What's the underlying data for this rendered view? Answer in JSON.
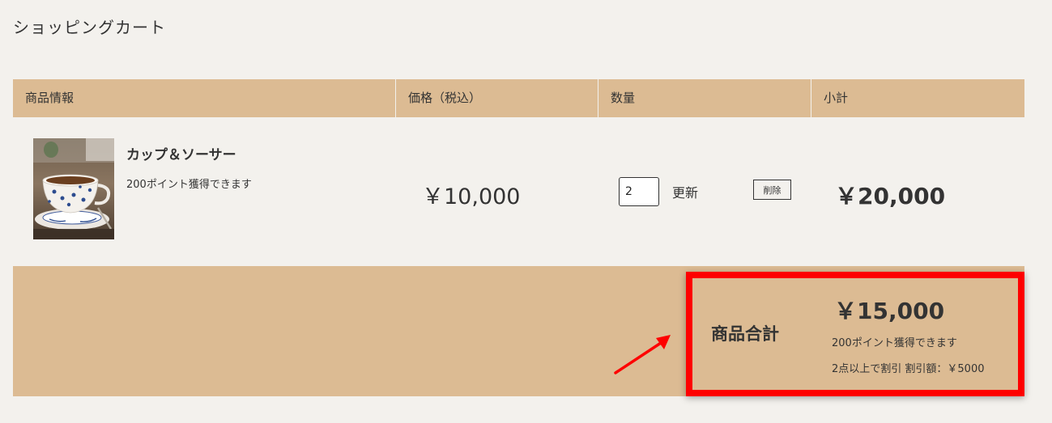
{
  "page": {
    "title": "ショッピングカート"
  },
  "table": {
    "headers": {
      "info": "商品情報",
      "price": "価格（税込）",
      "quantity": "数量",
      "subtotal": "小計"
    }
  },
  "item": {
    "name": "カップ＆ソーサー",
    "points": "200ポイント獲得できます",
    "unit_price": "￥10,000",
    "quantity": "2",
    "update_label": "更新",
    "delete_label": "削除",
    "subtotal": "￥20,000",
    "image_icon": "teacup-photo"
  },
  "summary": {
    "label": "商品合計",
    "amount": "￥15,000",
    "points": "200ポイント獲得できます",
    "discount": "2点以上で割引 割引額：￥5000"
  },
  "colors": {
    "background": "#f3f1ed",
    "accent": "#dcbb93",
    "highlight": "#fe0000"
  }
}
